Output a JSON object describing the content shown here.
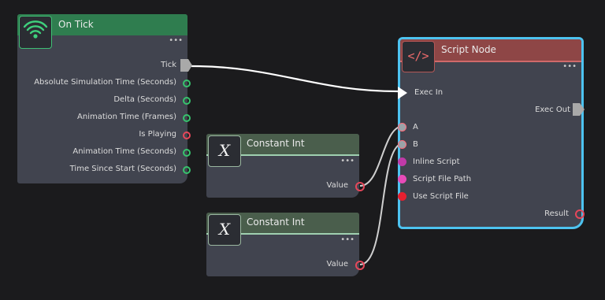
{
  "colors": {
    "background": "#1b1b1d",
    "node_body": "#41444f",
    "on_tick_header": "#2f7d4f",
    "constant_header": "#4a5e4c",
    "script_header": "#8e4646",
    "script_border": "#4dc3f0",
    "pin_green": "#37c36d",
    "pin_red": "#e6475a",
    "pin_grey": "#9aa3a8",
    "pin_magenta": "#c03aa8",
    "pin_pink": "#e84bb8"
  },
  "on_tick": {
    "title": "On Tick",
    "icon": "broadcast-icon",
    "menu": "•••",
    "tick_label": "Tick",
    "outputs": [
      {
        "label": "Absolute Simulation Time (Seconds)",
        "pin": "green"
      },
      {
        "label": "Delta (Seconds)",
        "pin": "green"
      },
      {
        "label": "Animation Time (Frames)",
        "pin": "green"
      },
      {
        "label": "Is Playing",
        "pin": "red"
      },
      {
        "label": "Animation Time (Seconds)",
        "pin": "green"
      },
      {
        "label": "Time Since Start (Seconds)",
        "pin": "green"
      }
    ]
  },
  "constant1": {
    "title": "Constant Int",
    "icon_glyph": "X",
    "menu": "•••",
    "output": "Value"
  },
  "constant2": {
    "title": "Constant Int",
    "icon_glyph": "X",
    "menu": "•••",
    "output": "Value"
  },
  "script": {
    "title": "Script Node",
    "icon_glyph": "</>",
    "menu": "•••",
    "exec_in": "Exec In",
    "exec_out": "Exec Out",
    "inputs": [
      {
        "label": "A",
        "pin": "grey"
      },
      {
        "label": "B",
        "pin": "grey"
      },
      {
        "label": "Inline Script",
        "pin": "magenta"
      },
      {
        "label": "Script File Path",
        "pin": "pink"
      },
      {
        "label": "Use Script File",
        "pin": "red"
      }
    ],
    "result": "Result"
  }
}
